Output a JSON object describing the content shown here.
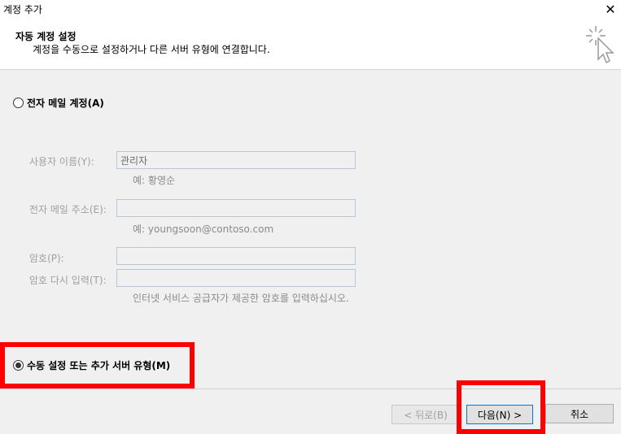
{
  "window": {
    "title": "계정 추가"
  },
  "header": {
    "title": "자동 계정 설정",
    "subtitle": "계정을 수동으로 설정하거나 다른 서버 유형에 연결합니다."
  },
  "options": {
    "email_account": "전자 메일 계정(A)",
    "manual_setup": "수동 설정 또는 추가 서버 유형(M)"
  },
  "form": {
    "username_label": "사용자 이름(Y):",
    "username_value": "관리자",
    "username_hint": "예: 황영순",
    "email_label": "전자 메일 주소(E):",
    "email_hint": "예: youngsoon@contoso.com",
    "password_label": "암호(P):",
    "confirm_label": "암호 다시 입력(T):",
    "password_hint": "인터넷 서비스 공급자가 제공한 암호를 입력하십시오."
  },
  "buttons": {
    "back": "< 뒤로(B)",
    "next": "다음(N) >",
    "cancel": "취소"
  },
  "colors": {
    "highlight": "#ff0000",
    "focus_border": "#0078d7"
  }
}
